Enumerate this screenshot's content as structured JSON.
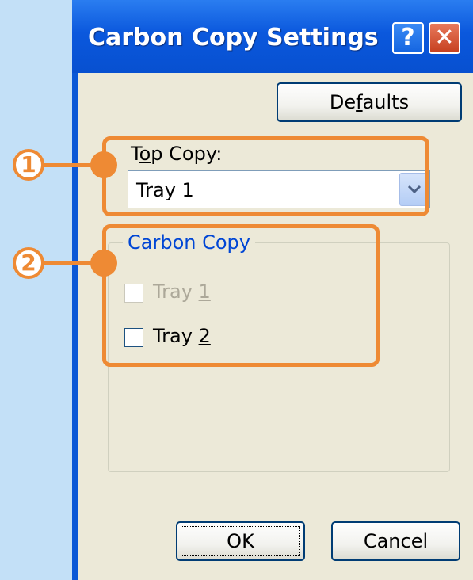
{
  "window": {
    "title": "Carbon Copy Settings",
    "help_glyph": "?",
    "close_glyph": "✕",
    "icons": [
      "help-icon",
      "close-icon"
    ]
  },
  "buttons": {
    "defaults": {
      "pre": "De",
      "underline": "f",
      "post": "aults"
    },
    "ok": "OK",
    "cancel": "Cancel"
  },
  "top_copy": {
    "label_pre": "T",
    "label_underline": "o",
    "label_post": "p Copy:",
    "selected": "Tray 1"
  },
  "carbon_copy": {
    "title": "Carbon Copy",
    "items": [
      {
        "pre": "Tray ",
        "underline": "1",
        "checked": false,
        "enabled": false
      },
      {
        "pre": "Tray ",
        "underline": "2",
        "checked": false,
        "enabled": true
      }
    ]
  },
  "callouts": [
    "1",
    "2"
  ],
  "colors": {
    "accent": "#ee8a34",
    "titlebar": "#0b58dd",
    "group_title": "#0046d5",
    "dialog_bg": "#ece9d8",
    "page_bg": "#c3e0f7"
  }
}
